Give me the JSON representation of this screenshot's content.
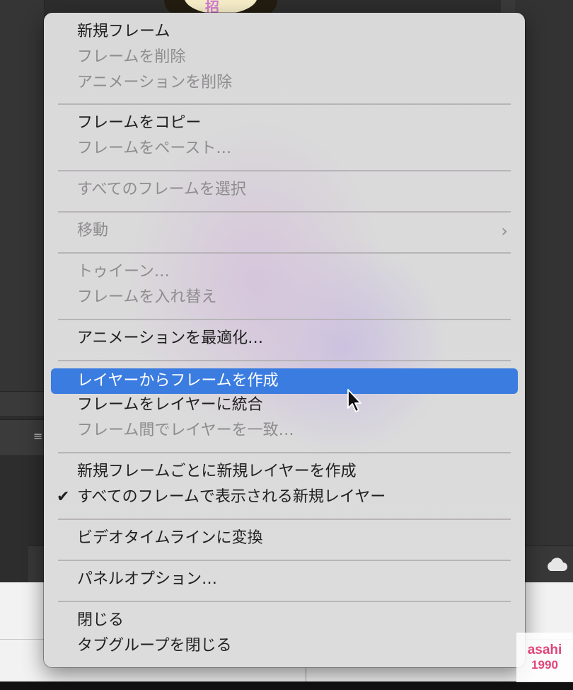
{
  "menu": {
    "items": [
      {
        "label": "新規フレーム",
        "disabled": false
      },
      {
        "label": "フレームを削除",
        "disabled": true
      },
      {
        "label": "アニメーションを削除",
        "disabled": true
      },
      {
        "label": "フレームをコピー",
        "disabled": false
      },
      {
        "label": "フレームをペースト…",
        "disabled": true
      },
      {
        "label": "すべてのフレームを選択",
        "disabled": true
      },
      {
        "label": "移動",
        "disabled": true,
        "submenu": true
      },
      {
        "label": "トゥイーン…",
        "disabled": true
      },
      {
        "label": "フレームを入れ替え",
        "disabled": true
      },
      {
        "label": "アニメーションを最適化…",
        "disabled": false
      },
      {
        "label": "レイヤーからフレームを作成",
        "disabled": false,
        "highlighted": true
      },
      {
        "label": "フレームをレイヤーに統合",
        "disabled": false
      },
      {
        "label": "フレーム間でレイヤーを一致…",
        "disabled": true
      },
      {
        "label": "新規フレームごとに新規レイヤーを作成",
        "disabled": false
      },
      {
        "label": "すべてのフレームで表示される新規レイヤー",
        "disabled": false,
        "checked": true
      },
      {
        "label": "ビデオタイムラインに変換",
        "disabled": false
      },
      {
        "label": "パネルオプション…",
        "disabled": false
      },
      {
        "label": "閉じる",
        "disabled": false
      },
      {
        "label": "タブグループを閉じる",
        "disabled": false
      }
    ],
    "check_glyph": "✔",
    "submenu_glyph": "›"
  },
  "background": {
    "thumbnail_text": "招"
  },
  "watermark": {
    "line1": "asahi",
    "line2": "1990"
  },
  "colors": {
    "highlight": "#3b7ce0",
    "disabled_text": "#8f8c8f",
    "watermark": "#e0457b"
  }
}
